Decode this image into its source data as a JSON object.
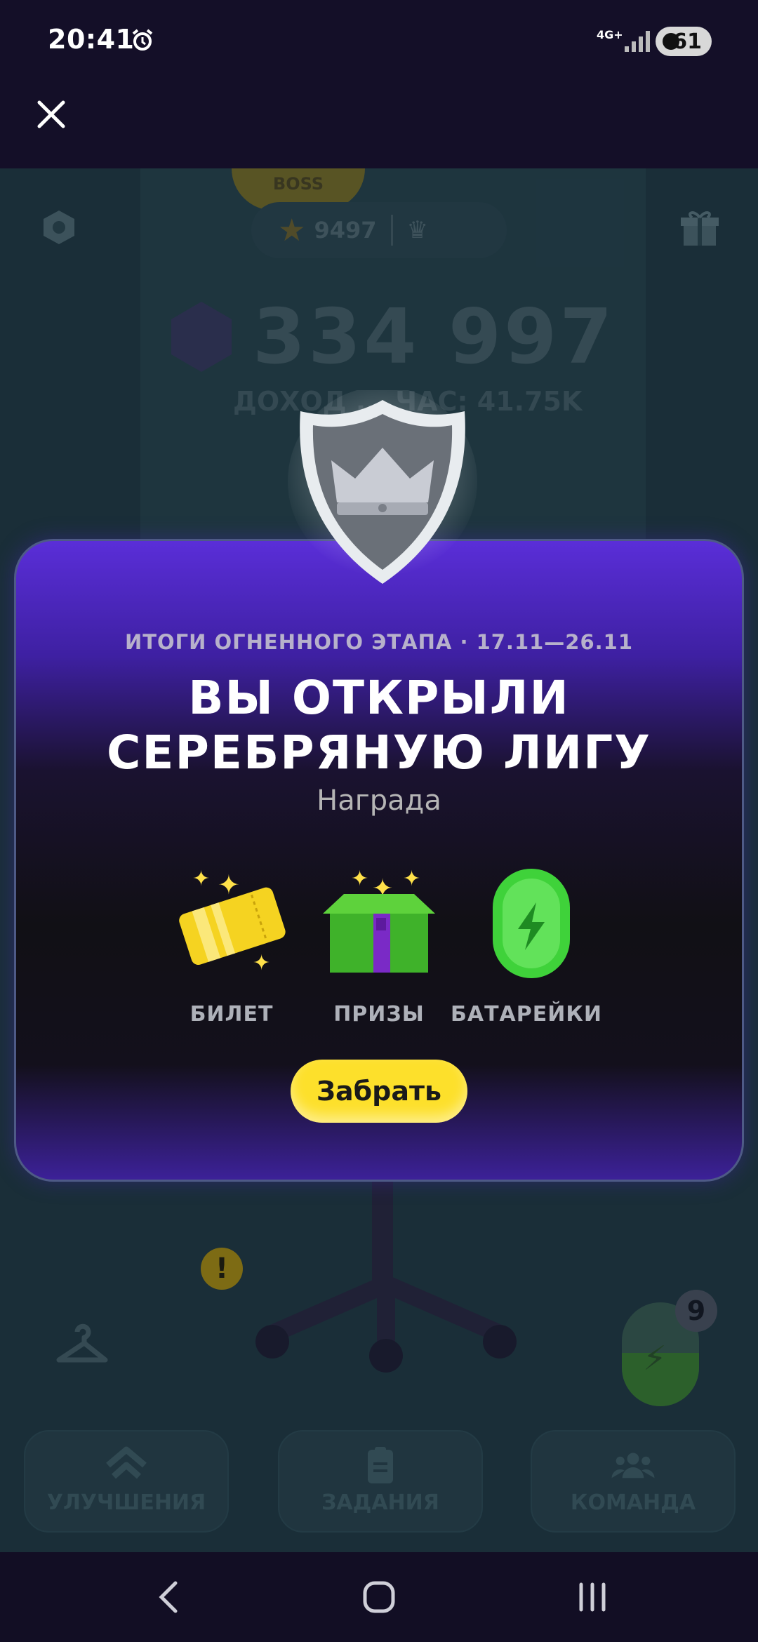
{
  "status_bar": {
    "time": "20:41",
    "network": "4G+",
    "battery": "61",
    "icons": [
      "alarm-icon",
      "signal-icon",
      "battery-saver-icon"
    ]
  },
  "top_bar": {
    "close_icon": "close-icon"
  },
  "game": {
    "trophy_text": "BOSS",
    "stars": "9497",
    "balance": "334 997",
    "income": "ДОХОД ... ЧАС: 41.75K",
    "energy_count": "9",
    "nav": [
      {
        "label": "УЛУЧШЕНИЯ",
        "icon": "upgrade-chevrons-icon",
        "alert": "!"
      },
      {
        "label": "ЗАДАНИЯ",
        "icon": "clipboard-icon"
      },
      {
        "label": "КОМАНДА",
        "icon": "team-icon"
      }
    ]
  },
  "modal": {
    "subtitle": "ИТОГИ ОГНЕННОГО ЭТАПА · 17.11—26.11",
    "title_line1": "ВЫ ОТКРЫЛИ",
    "title_line2": "СЕРЕБРЯНУЮ ЛИГУ",
    "reward_label": "Награда",
    "rewards": [
      {
        "label": "БИЛЕТ",
        "icon": "ticket-icon"
      },
      {
        "label": "ПРИЗЫ",
        "icon": "prize-box-icon"
      },
      {
        "label": "БАТАРЕЙКИ",
        "icon": "battery-energy-icon"
      }
    ],
    "claim_button": "Забрать",
    "league_icon": "silver-league-shield-icon"
  },
  "colors": {
    "accent_yellow": "#fde02b",
    "modal_purple": "#5a2ed8",
    "background": "#1f3a44"
  }
}
